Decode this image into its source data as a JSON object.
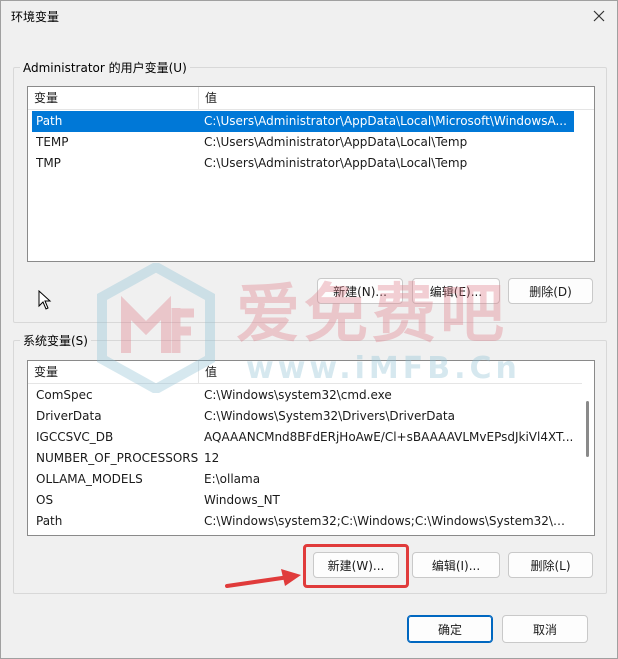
{
  "window": {
    "title": "环境变量"
  },
  "user_vars": {
    "group_label": "Administrator 的用户变量(U)",
    "columns": [
      "变量",
      "值"
    ],
    "rows": [
      {
        "name": "Path",
        "value": "C:\\Users\\Administrator\\AppData\\Local\\Microsoft\\WindowsA..."
      },
      {
        "name": "TEMP",
        "value": "C:\\Users\\Administrator\\AppData\\Local\\Temp"
      },
      {
        "name": "TMP",
        "value": "C:\\Users\\Administrator\\AppData\\Local\\Temp"
      }
    ],
    "new_label": "新建(N)...",
    "edit_label": "编辑(E)...",
    "delete_label": "删除(D)"
  },
  "system_vars": {
    "group_label": "系统变量(S)",
    "columns": [
      "变量",
      "值"
    ],
    "rows": [
      {
        "name": "ComSpec",
        "value": "C:\\Windows\\system32\\cmd.exe"
      },
      {
        "name": "DriverData",
        "value": "C:\\Windows\\System32\\Drivers\\DriverData"
      },
      {
        "name": "IGCCSVC_DB",
        "value": "AQAAANCMnd8BFdERjHoAwE/Cl+sBAAAAVLMvEPsdJkiVl4XT..."
      },
      {
        "name": "NUMBER_OF_PROCESSORS",
        "value": "12"
      },
      {
        "name": "OLLAMA_MODELS",
        "value": "E:\\ollama"
      },
      {
        "name": "OS",
        "value": "Windows_NT"
      },
      {
        "name": "Path",
        "value": "C:\\Windows\\system32;C:\\Windows;C:\\Windows\\System32\\Wb..."
      }
    ],
    "new_label": "新建(W)...",
    "edit_label": "编辑(I)...",
    "delete_label": "删除(L)"
  },
  "footer": {
    "ok_label": "确定",
    "cancel_label": "取消"
  },
  "watermark": {
    "text": "爱免费吧",
    "url": "www.iMFB.Cn"
  },
  "colors": {
    "selection": "#0078d7",
    "annotation": "#e03b3b",
    "primary_border": "#0067c0"
  }
}
